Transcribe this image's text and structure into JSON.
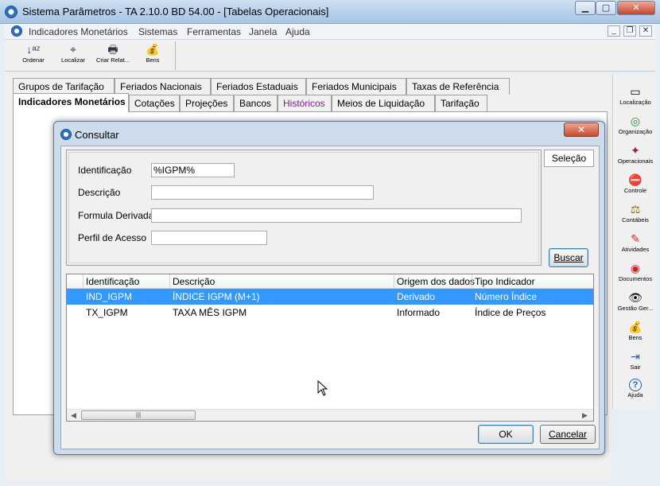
{
  "window": {
    "title": "Sistema Parâmetros -  TA 2.10.0 BD 54.00 - [Tabelas Operacionais]",
    "min_glyph": "▁",
    "max_glyph": "▢",
    "close_glyph": "✕"
  },
  "menu": {
    "items": [
      "Indicadores Monetários",
      "Sistemas",
      "Ferramentas",
      "Janela",
      "Ajuda"
    ],
    "mdi_min": "_",
    "mdi_restore": "❐",
    "mdi_close": "✕"
  },
  "toolbar": {
    "buttons": [
      {
        "label": "Ordenar",
        "icon": "sort-az-icon",
        "glyph": "↓ᵃᶻ"
      },
      {
        "label": "Localizar",
        "icon": "find-icon",
        "glyph": "⌖"
      },
      {
        "label": "Criar Relat...",
        "icon": "printer-icon",
        "glyph": "🖶"
      },
      {
        "label": "Bens",
        "icon": "money-bag-icon",
        "glyph": "💰"
      }
    ]
  },
  "tabs": {
    "row1": [
      "Grupos de Tarifação",
      "Feriados Nacionais",
      "Feriados Estaduais",
      "Feriados Municipais",
      "Taxas de Referência"
    ],
    "row2": [
      "Indicadores Monetários",
      "Cotações",
      "Projeções",
      "Bancos",
      "Históricos",
      "Meios de Liquidação",
      "Tarifação"
    ],
    "active": "Indicadores Monetários"
  },
  "sidepanel": {
    "items": [
      {
        "label": "Localização",
        "icon": "location-icon",
        "glyph": "▭"
      },
      {
        "label": "Organização",
        "icon": "organization-icon",
        "glyph": "◎"
      },
      {
        "label": "Operacionais",
        "icon": "operations-icon",
        "glyph": "✦"
      },
      {
        "label": "Controle",
        "icon": "control-icon",
        "glyph": "⛔"
      },
      {
        "label": "Contábeis",
        "icon": "scales-icon",
        "glyph": "⚖"
      },
      {
        "label": "Atividades",
        "icon": "activities-icon",
        "glyph": "✎"
      },
      {
        "label": "Documentos",
        "icon": "documents-icon",
        "glyph": "◉"
      },
      {
        "label": "Gestão Ger...",
        "icon": "management-icon",
        "glyph": "👁"
      },
      {
        "label": "Bens",
        "icon": "money-bag-icon",
        "glyph": "💰"
      },
      {
        "label": "Sair",
        "icon": "exit-icon",
        "glyph": "⇥"
      },
      {
        "label": "Ajuda",
        "icon": "help-icon",
        "glyph": "?"
      }
    ]
  },
  "dialog": {
    "title": "Consultar",
    "close_glyph": "✕",
    "selection_tab": "Seleção",
    "fields": {
      "identificacao": {
        "label": "Identificação",
        "value": "%IGPM%"
      },
      "descricao": {
        "label": "Descrição",
        "value": ""
      },
      "formula": {
        "label": "Formula Derivada",
        "value": ""
      },
      "perfil": {
        "label": "Perfil de Acesso",
        "value": ""
      }
    },
    "search_button": "Buscar",
    "grid": {
      "columns": [
        "Identificação",
        "Descrição",
        "Origem dos dados",
        "Tipo Indicador"
      ],
      "rows": [
        [
          "IND_IGPM",
          "ÍNDICE IGPM (M+1)",
          "Derivado",
          "Número Índice"
        ],
        [
          "TX_IGPM",
          "TAXA MÊS IGPM",
          "Informado",
          "Índice de Preços"
        ]
      ],
      "selected_row": 0
    },
    "ok_button": "OK",
    "cancel_button": "Cancelar"
  }
}
